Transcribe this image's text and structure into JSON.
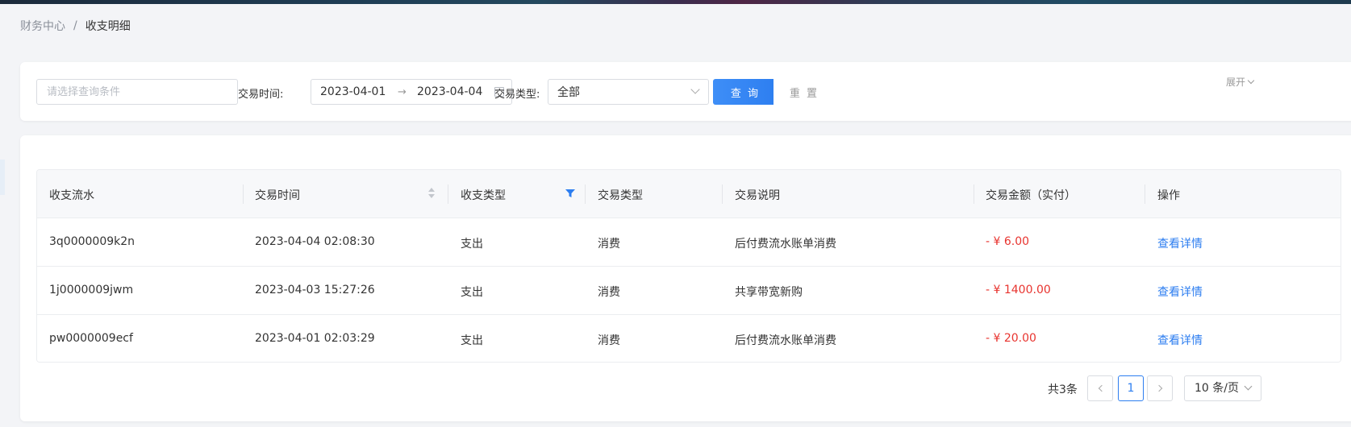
{
  "breadcrumb": {
    "parent": "财务中心",
    "separator": "/",
    "current": "收支明细"
  },
  "filters": {
    "search_placeholder": "请选择查询条件",
    "time_label": "交易时间:",
    "date_start": "2023-04-01",
    "date_arrow": "→",
    "date_end": "2023-04-04",
    "type_label": "交易类型:",
    "type_value": "全部",
    "query_button": "查 询",
    "reset_button": "重 置",
    "expand_label": "展开"
  },
  "table": {
    "columns": [
      "收支流水",
      "交易时间",
      "收支类型",
      "交易类型",
      "交易说明",
      "交易金额（实付）",
      "操作"
    ],
    "rows": [
      {
        "serial": "3q0000009k2n",
        "time": "2023-04-04 02:08:30",
        "direction": "支出",
        "type": "消费",
        "desc": "后付费流水账单消费",
        "amount": "- ¥ 6.00",
        "action": "查看详情"
      },
      {
        "serial": "1j0000009jwm",
        "time": "2023-04-03 15:27:26",
        "direction": "支出",
        "type": "消费",
        "desc": "共享带宽新购",
        "amount": "- ¥ 1400.00",
        "action": "查看详情"
      },
      {
        "serial": "pw0000009ecf",
        "time": "2023-04-01 02:03:29",
        "direction": "支出",
        "type": "消费",
        "desc": "后付费流水账单消费",
        "amount": "- ¥ 20.00",
        "action": "查看详情"
      }
    ]
  },
  "pagination": {
    "total": "共3条",
    "current_page": "1",
    "page_size": "10 条/页"
  },
  "colors": {
    "primary": "#2d7ef0",
    "amount": "#e8342f"
  }
}
